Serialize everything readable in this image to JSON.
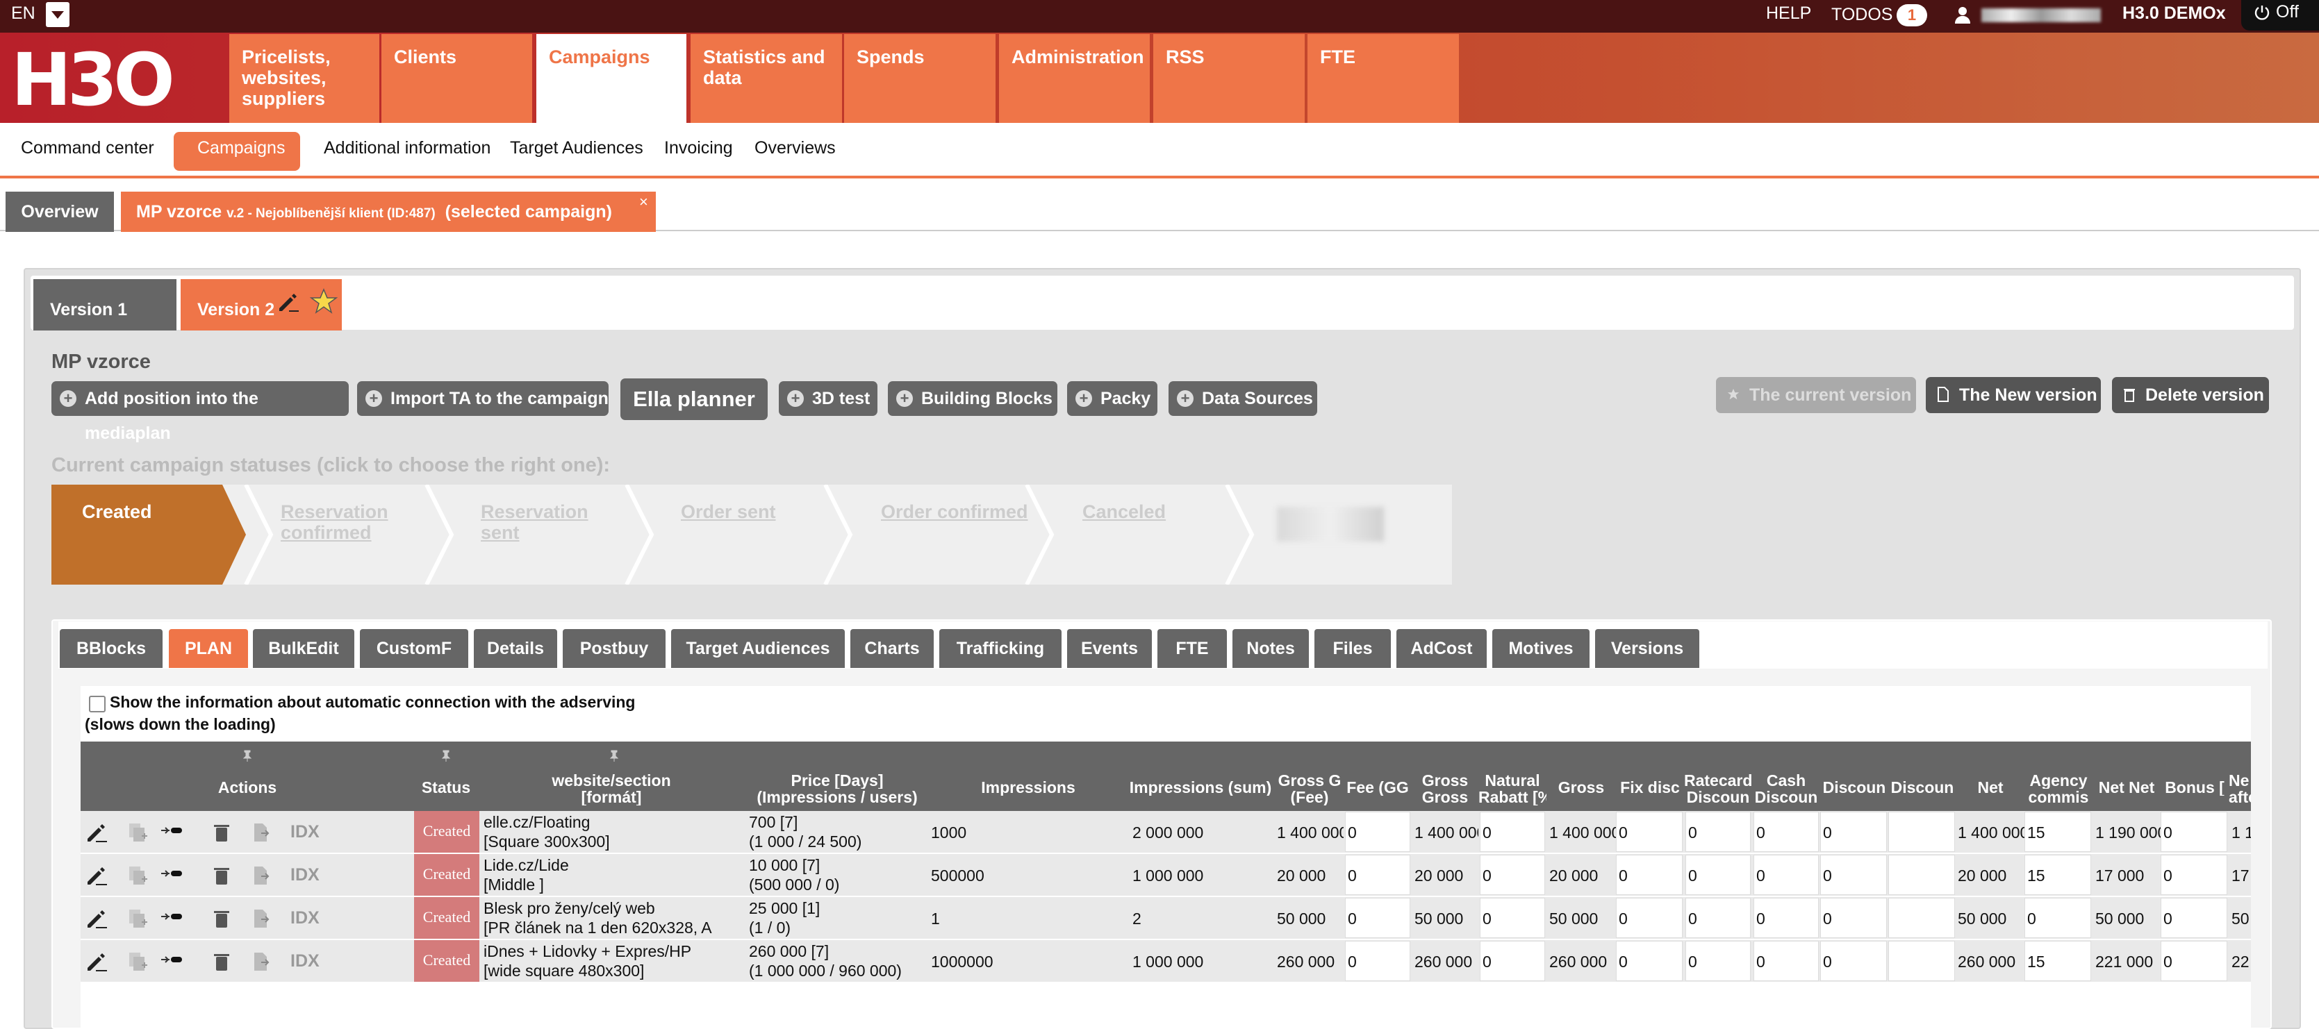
{
  "topbar": {
    "lang": "EN",
    "help": "HELP",
    "todos_label": "TODOS",
    "todos_count": "1",
    "account": "H3.0 DEMOx",
    "toggle_label": "Off"
  },
  "logo": "H3O",
  "nav": [
    "Pricelists, websites, suppliers",
    "Clients",
    "Campaigns",
    "Statistics and data",
    "Spends",
    "Administration",
    "RSS",
    "FTE"
  ],
  "nav_active": "Campaigns",
  "subnav": [
    "Command center",
    "Campaigns",
    "Additional information",
    "Target Audiences",
    "Invoicing",
    "Overviews"
  ],
  "campaign_tabs": {
    "overview": "Overview",
    "selected_title": "MP vzorce",
    "selected_detail": "v.2 - Nejoblíbenější klient (ID:487)",
    "selected_suffix": "(selected campaign)",
    "close": "×"
  },
  "versions": {
    "v1": "Version 1",
    "v2": "Version 2"
  },
  "mp_title": "MP vzorce",
  "actions": [
    "Add position into the mediaplan",
    "Import TA to the campaign",
    "Ella planner",
    "3D test",
    "Building Blocks",
    "Packy",
    "Data Sources"
  ],
  "version_actions": [
    "The current version",
    "The New version",
    "Delete version"
  ],
  "status_heading": "Current campaign statuses (click to choose the right one):",
  "statuses": [
    "Created",
    "Reservation confirmed",
    "Reservation sent",
    "Order sent",
    "Order confirmed",
    "Canceled"
  ],
  "plan_tabs": [
    "BBlocks",
    "PLAN",
    "BulkEdit",
    "CustomF",
    "Details",
    "Postbuy",
    "Target Audiences",
    "Charts",
    "Trafficking",
    "Events",
    "FTE",
    "Notes",
    "Files",
    "AdCost",
    "Motives",
    "Versions"
  ],
  "plan_tab_active": "PLAN",
  "adserving": {
    "label": "Show the information about automatic connection with the adserving",
    "note": "(slows down the loading)"
  },
  "table": {
    "headers": [
      "Actions",
      "Status",
      "website/section",
      "[formát]",
      "Price [Days]",
      "(Impressions / users)",
      "Impressions",
      "Impressions (sum)",
      "Gross G",
      "(Fee)",
      "Fee (GG",
      "Gross",
      "Gross",
      "Natural",
      "Rabatt [%",
      "Gross",
      "Fix disc",
      "Ratecard",
      "Discoun",
      "Cash",
      "Discoun",
      "Discoun",
      "Discoun",
      "Net",
      "Agency",
      "commis",
      "Net Net",
      "Bonus [",
      "Ne",
      "afte"
    ],
    "idx_label": "IDX",
    "rows": [
      {
        "status": "Created",
        "site": "elle.cz/Floating",
        "format": "[Square 300x300]",
        "price": "700 [7]",
        "users": "(1 000 / 24 500)",
        "impr": "1000",
        "impr_sum": "2 000 000",
        "gross_g": "1 400 000",
        "fee": "0",
        "gross_gross": "1 400 000",
        "natural": "0",
        "gross": "1 400 000",
        "fix": "0",
        "ratecard": "0",
        "cash": "0",
        "disc1": "0",
        "disc2": "",
        "net": "1 400 000",
        "agency": "15",
        "netnet": "1 190 000",
        "bonus": "0",
        "after": "1 1"
      },
      {
        "status": "Created",
        "site": "Lide.cz/Lide",
        "format": "[Middle ]",
        "price": "10 000 [7]",
        "users": "(500 000 / 0)",
        "impr": "500000",
        "impr_sum": "1 000 000",
        "gross_g": "20 000",
        "fee": "0",
        "gross_gross": "20 000",
        "natural": "0",
        "gross": "20 000",
        "fix": "0",
        "ratecard": "0",
        "cash": "0",
        "disc1": "0",
        "disc2": "",
        "net": "20 000",
        "agency": "15",
        "netnet": "17 000",
        "bonus": "0",
        "after": "17"
      },
      {
        "status": "Created",
        "site": "Blesk pro ženy/celý web",
        "format": "[PR článek na 1 den 620x328, A",
        "price": "25 000 [1]",
        "users": "(1 / 0)",
        "impr": "1",
        "impr_sum": "2",
        "gross_g": "50 000",
        "fee": "0",
        "gross_gross": "50 000",
        "natural": "0",
        "gross": "50 000",
        "fix": "0",
        "ratecard": "0",
        "cash": "0",
        "disc1": "0",
        "disc2": "",
        "net": "50 000",
        "agency": "0",
        "netnet": "50 000",
        "bonus": "0",
        "after": "50"
      },
      {
        "status": "Created",
        "site": "iDnes + Lidovky + Expres/HP",
        "format": "[wide square 480x300]",
        "price": "260 000 [7]",
        "users": "(1 000 000 / 960 000)",
        "impr": "1000000",
        "impr_sum": "1 000 000",
        "gross_g": "260 000",
        "fee": "0",
        "gross_gross": "260 000",
        "natural": "0",
        "gross": "260 000",
        "fix": "0",
        "ratecard": "0",
        "cash": "0",
        "disc1": "0",
        "disc2": "",
        "net": "260 000",
        "agency": "15",
        "netnet": "221 000",
        "bonus": "0",
        "after": "22"
      }
    ]
  },
  "colors": {
    "accent": "#ef7548",
    "topbar": "#4a1313",
    "status_created": "#c0702a",
    "status_cell": "#d47b7b"
  }
}
